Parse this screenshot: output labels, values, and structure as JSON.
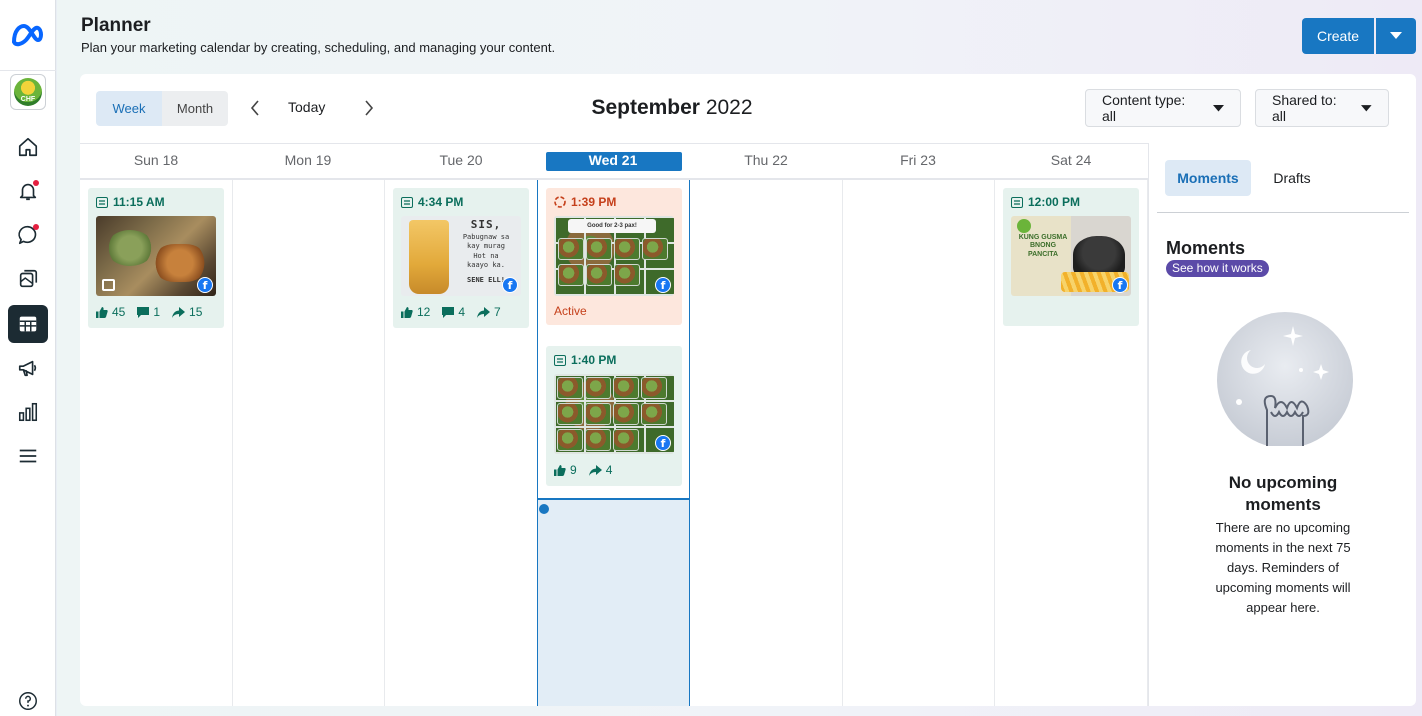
{
  "app": {
    "title": "Planner",
    "subtitle": "Plan your marketing calendar by creating, scheduling, and managing your content.",
    "create_label": "Create",
    "accent_color": "#1877c2"
  },
  "rail": {
    "nav_items": [
      "home-icon",
      "notifications-icon",
      "inbox-icon",
      "content-icon",
      "planner-icon",
      "ads-icon",
      "insights-icon",
      "menu-icon"
    ],
    "help_icon": "help-icon",
    "avatar_label": "CHF"
  },
  "toolbar": {
    "week_label": "Week",
    "month_label": "Month",
    "today_label": "Today",
    "month_name": "September",
    "year": "2022",
    "content_type": "Content type: all",
    "shared_to": "Shared to: all"
  },
  "days": [
    {
      "label": "Sun 18"
    },
    {
      "label": "Mon 19"
    },
    {
      "label": "Tue 20"
    },
    {
      "label": "Wed 21",
      "today": true
    },
    {
      "label": "Thu 22"
    },
    {
      "label": "Fri 23"
    },
    {
      "label": "Sat 24"
    }
  ],
  "posts": {
    "sun": {
      "time": "11:15 AM",
      "likes": "45",
      "comments": "1",
      "shares": "15"
    },
    "tue": {
      "time": "4:34 PM",
      "likes": "12",
      "comments": "4",
      "shares": "7",
      "image_text": [
        "SIS,",
        "Pabugnaw sa",
        "kay murag",
        "Hot na",
        "kaayo ka.",
        "SENE ELL!"
      ]
    },
    "wed_active": {
      "time": "1:39 PM",
      "status": "Active",
      "image_text": "Good for 2-3 pax!"
    },
    "wed": {
      "time": "1:40 PM",
      "likes": "9",
      "shares": "4"
    },
    "sat": {
      "time": "12:00 PM",
      "image_text": "KUNG GUSMA BNONG PANCITA"
    }
  },
  "panel": {
    "tab_moments": "Moments",
    "tab_drafts": "Drafts",
    "heading": "Moments",
    "see_how": "See how it works",
    "empty_title": "No upcoming moments",
    "empty_text": "There are no upcoming moments in the next 75 days. Reminders of upcoming moments will appear here."
  }
}
